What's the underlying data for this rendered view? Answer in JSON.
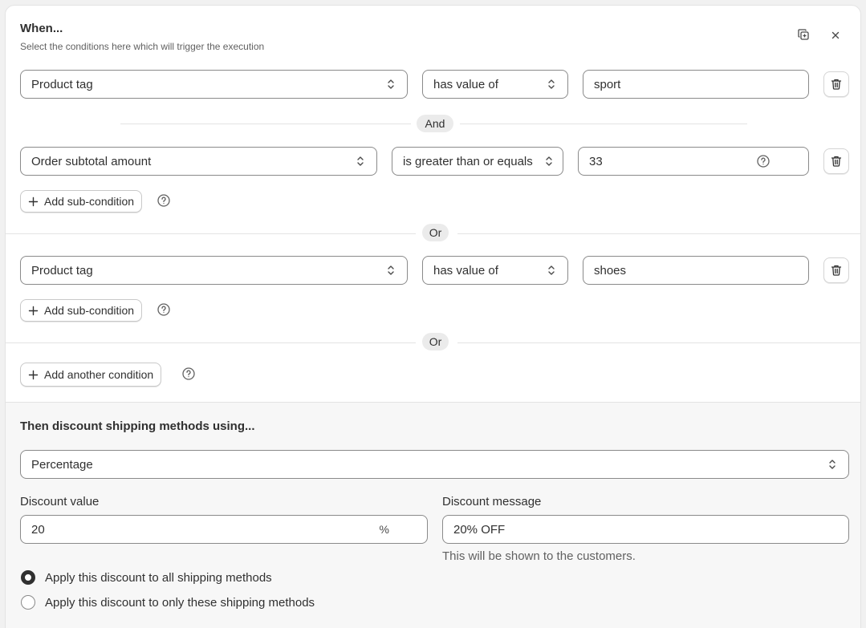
{
  "header": {
    "title": "When...",
    "subtitle": "Select the conditions here which will trigger the execution"
  },
  "conditions": {
    "row1": {
      "field": "Product tag",
      "operator": "has value of",
      "value": "sport"
    },
    "and_label": "And",
    "row2": {
      "field": "Order subtotal amount",
      "operator": "is greater than or equals",
      "value": "33"
    },
    "add_sub_label": "Add sub-condition",
    "or_label": "Or",
    "row3": {
      "field": "Product tag",
      "operator": "has value of",
      "value": "shoes"
    },
    "add_another_label": "Add another condition"
  },
  "then": {
    "title": "Then discount shipping methods using...",
    "method": "Percentage",
    "discount_value_label": "Discount value",
    "discount_value": "20",
    "discount_suffix": "%",
    "discount_message_label": "Discount message",
    "discount_message": "20% OFF",
    "message_hint": "This will be shown to the customers.",
    "radio_all": "Apply this discount to all shipping methods",
    "radio_some": "Apply this discount to only these shipping methods",
    "selected_radio": "all"
  },
  "icons": {
    "duplicate": "duplicate-icon",
    "close": "close-icon",
    "delete": "trash-icon",
    "select_chevron": "chevron-up-down-icon",
    "help": "question-circle-icon",
    "add": "plus-icon"
  },
  "colors": {
    "border": "#8a8a8a",
    "text": "#303030",
    "muted": "#616161",
    "section_bg": "#f7f7f7"
  }
}
